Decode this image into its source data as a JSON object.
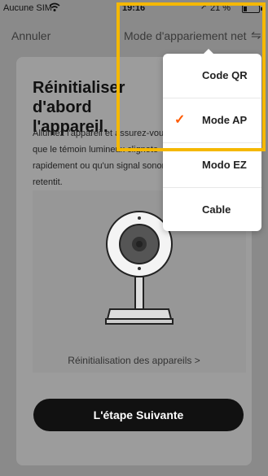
{
  "status_bar": {
    "carrier": "Aucune SIM",
    "time": "19:16",
    "battery": "21 %",
    "battery_level": 0.21
  },
  "nav": {
    "cancel": "Annuler",
    "mode_label": "Mode d'appariement net"
  },
  "main": {
    "title": "Réinitialiser d'abord l'appareil.",
    "description": "Allumez l'appareil et assurez-vous que le témoin lumineux clignote rapidement ou qu'un signal sonore retentit.",
    "reset_link": "Réinitialisation des appareils >",
    "next_button": "L'étape Suivante"
  },
  "dropdown": {
    "items": [
      {
        "label": "Code QR",
        "selected": false
      },
      {
        "label": "Mode AP",
        "selected": true
      },
      {
        "label": "Modo EZ",
        "selected": false
      },
      {
        "label": "Cable",
        "selected": false
      }
    ],
    "check_color": "#ff5a00"
  },
  "colors": {
    "highlight": "#f5b800",
    "button_bg": "#111111"
  }
}
